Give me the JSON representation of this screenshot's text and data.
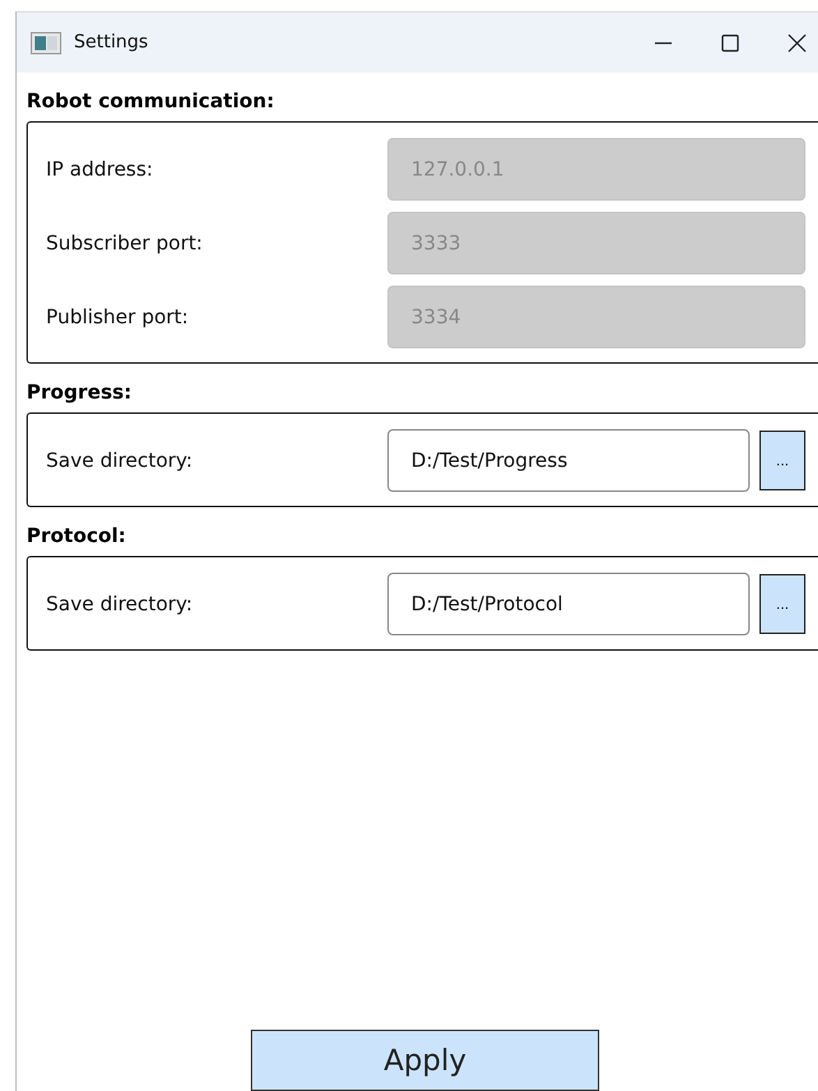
{
  "window": {
    "title": "Settings"
  },
  "sections": [
    {
      "title": "Robot communication:",
      "rows": [
        {
          "label": "IP address:",
          "value": "127.0.0.1",
          "disabled": true
        },
        {
          "label": "Subscriber port:",
          "value": "3333",
          "disabled": true
        },
        {
          "label": "Publisher port:",
          "value": "3334",
          "disabled": true
        }
      ]
    },
    {
      "title": "Progress:",
      "rows": [
        {
          "label": "Save directory:",
          "value": "D:/Test/Progress",
          "disabled": false,
          "browse": "..."
        }
      ]
    },
    {
      "title": "Protocol:",
      "rows": [
        {
          "label": "Save directory:",
          "value": "D:/Test/Protocol",
          "disabled": false,
          "browse": "..."
        }
      ]
    }
  ],
  "apply_button": "Apply"
}
